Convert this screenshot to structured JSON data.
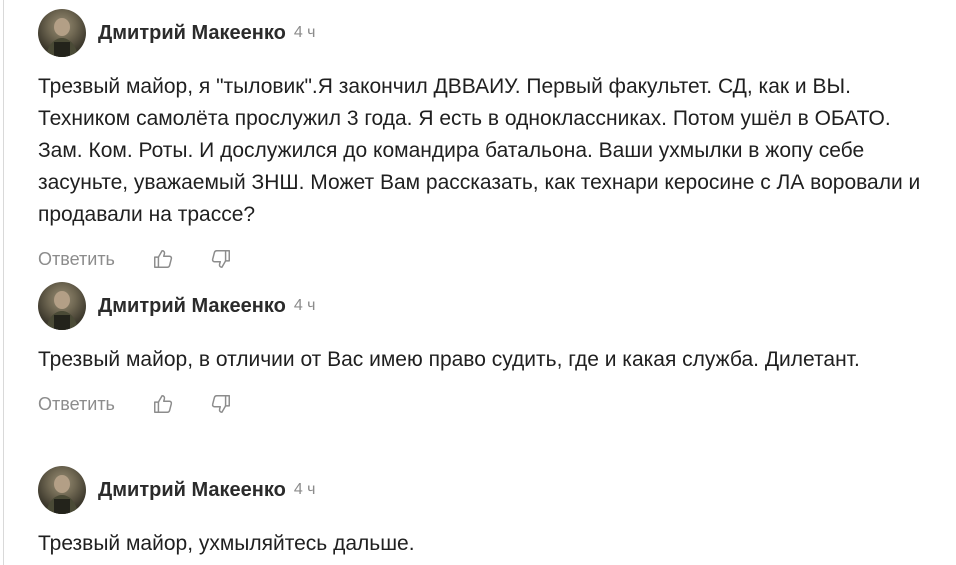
{
  "comments": [
    {
      "author": "Дмитрий Макеенко",
      "time": "4 ч",
      "text": "Трезвый майор, я \"тыловик\".Я закончил ДВВАИУ. Первый факультет. СД, как и ВЫ. Техником самолёта прослужил 3 года. Я есть в одноклассниках. Потом ушёл в ОБАТО. Зам. Ком. Роты. И дослужился до командира батальона. Ваши ухмылки в жопу себе засуньте, уважаемый ЗНШ. Может Вам рассказать, как технари керосине с ЛА воровали и продавали на трассе?",
      "reply_label": "Ответить"
    },
    {
      "author": "Дмитрий Макеенко",
      "time": "4 ч",
      "text": "Трезвый майор, в отличии от Вас имею право судить, где и какая служба. Дилетант.",
      "reply_label": "Ответить"
    },
    {
      "author": "Дмитрий Макеенко",
      "time": "4 ч",
      "text": "Трезвый майор, ухмыляйтесь дальше."
    }
  ],
  "icons": {
    "like": "thumbs-up-icon",
    "dislike": "thumbs-down-icon"
  },
  "colors": {
    "text": "#1f1f1f",
    "muted": "#8c8c8c",
    "divider": "#d9d9d9"
  }
}
